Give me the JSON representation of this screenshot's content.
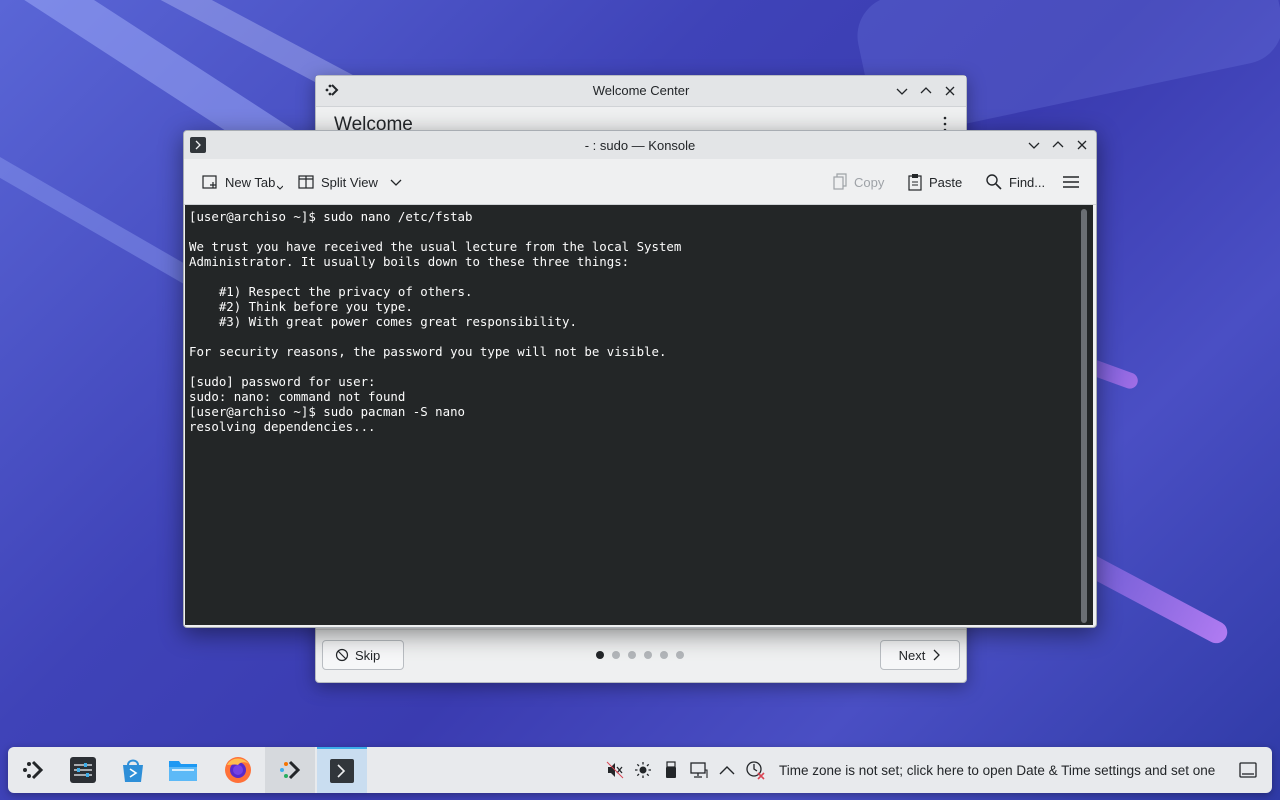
{
  "welcome_window": {
    "title": "Welcome Center",
    "heading": "Welcome",
    "skip_label": "Skip",
    "next_label": "Next",
    "page_count": 6,
    "active_page": 1
  },
  "konsole": {
    "title": "- : sudo — Konsole",
    "toolbar": {
      "new_tab": "New Tab",
      "split_view": "Split View",
      "copy": "Copy",
      "paste": "Paste",
      "find": "Find..."
    },
    "terminal_output": "[user@archiso ~]$ sudo nano /etc/fstab\n\nWe trust you have received the usual lecture from the local System\nAdministrator. It usually boils down to these three things:\n\n    #1) Respect the privacy of others.\n    #2) Think before you type.\n    #3) With great power comes great responsibility.\n\nFor security reasons, the password you type will not be visible.\n\n[sudo] password for user:\nsudo: nano: command not found\n[user@archiso ~]$ sudo pacman -S nano\nresolving dependencies...",
    "colors": {
      "terminal_bg": "#232627",
      "terminal_fg": "#fcfcfc"
    }
  },
  "taskbar": {
    "apps": [
      {
        "name": "application-launcher-icon"
      },
      {
        "name": "system-settings-icon"
      },
      {
        "name": "discover-store-icon"
      },
      {
        "name": "dolphin-files-icon"
      },
      {
        "name": "firefox-icon"
      },
      {
        "name": "welcome-center-icon"
      },
      {
        "name": "konsole-icon"
      }
    ],
    "tray_icons": [
      "volume-muted-icon",
      "brightness-icon",
      "usb-device-icon",
      "network-icon",
      "show-hidden-icon",
      "clock-alert-icon"
    ],
    "timezone_message": "Time zone is not set; click here to open Date & Time settings and set one",
    "accent": "#3daee9"
  }
}
